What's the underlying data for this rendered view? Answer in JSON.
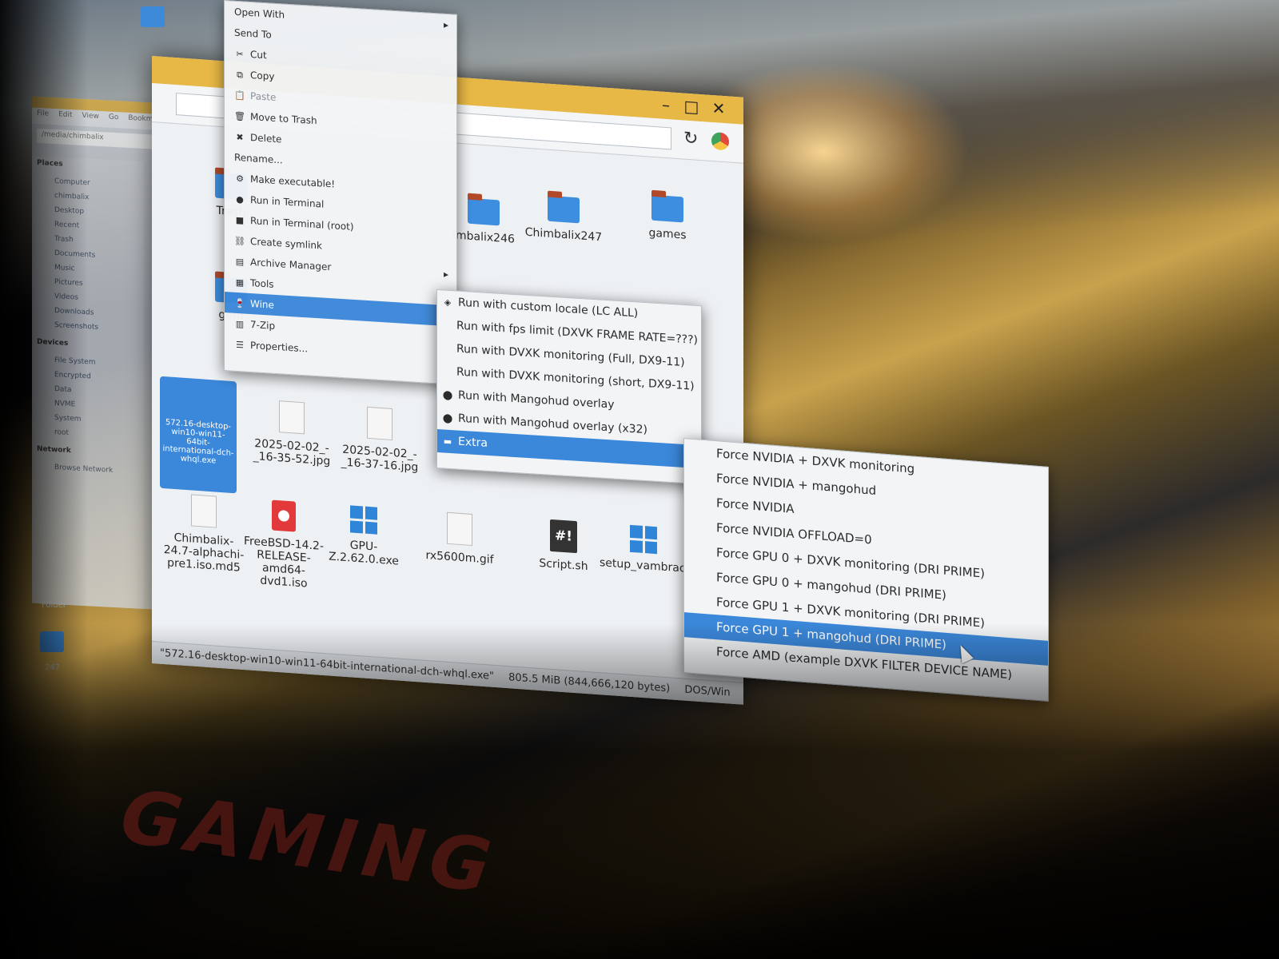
{
  "background_window": {
    "menubar": [
      "File",
      "Edit",
      "View",
      "Go",
      "Bookmarks",
      "H"
    ],
    "address": "/media/chimbalix",
    "places_header": "Places",
    "places": [
      "Computer",
      "chimbalix",
      "Desktop",
      "Recent",
      "Trash",
      "Documents",
      "Music",
      "Pictures",
      "Videos",
      "Downloads",
      "Screenshots"
    ],
    "devices_header": "Devices",
    "devices": [
      "File System",
      "Encrypted",
      "Data",
      "NVME",
      "System",
      "root"
    ],
    "network_header": "Network",
    "network": [
      "Browse Network"
    ]
  },
  "desktop": {
    "folder_label": "Folder",
    "folder2_label": "247"
  },
  "bezel_text": "GAMING",
  "window": {
    "controls": {
      "minimize": "–",
      "maximize": "□",
      "close": "✕"
    },
    "address": "",
    "reload_icon": "↻",
    "items": [
      {
        "label": "Trash",
        "kind": "folder"
      },
      {
        "label": "imbalix246",
        "kind": "folder"
      },
      {
        "label": "Chimbalix247",
        "kind": "folder"
      },
      {
        "label": "games",
        "kind": "folder"
      },
      {
        "label": "gem",
        "kind": "folder"
      },
      {
        "label": "2025-02-02_-_16-35-52.jpg",
        "kind": "file"
      },
      {
        "label": "2025-02-02_-_16-37-16.jpg",
        "kind": "file"
      },
      {
        "label": "Chimbalix-24.7-alphachi-pre1.iso.md5",
        "kind": "file"
      },
      {
        "label": "FreeBSD-14.2-RELEASE-amd64-dvd1.iso",
        "kind": "iso"
      },
      {
        "label": "GPU-Z.2.62.0.exe",
        "kind": "exe"
      },
      {
        "label": "rx5600m.gif",
        "kind": "file"
      },
      {
        "label": "Script.sh",
        "kind": "sh"
      },
      {
        "label": "setup_vambrace_cold_soul_1.11_(64bit)_(36921).exe",
        "kind": "exe"
      }
    ],
    "selected_item": "572.16-desktop-win10-win11-64bit-international-dch-whql.exe",
    "status": {
      "file": "\"572.16-desktop-win10-win11-64bit-international-dch-whql.exe\"",
      "size": "805.5 MiB (844,666,120 bytes)",
      "type": "DOS/Win"
    }
  },
  "context_menu": [
    {
      "label": "Open With",
      "submenu": true
    },
    {
      "label": "Send To",
      "submenu": false
    },
    {
      "label": "Cut",
      "icon": "cut-icon",
      "glyph": "✂"
    },
    {
      "label": "Copy",
      "icon": "copy-icon",
      "glyph": "⧉"
    },
    {
      "label": "Paste",
      "icon": "paste-icon",
      "glyph": "📋",
      "disabled": true
    },
    {
      "label": "Move to Trash",
      "icon": "trash-icon",
      "glyph": "🗑"
    },
    {
      "label": "Delete",
      "icon": "delete-icon",
      "glyph": "✖"
    },
    {
      "label": "Rename...",
      "icon": "",
      "glyph": ""
    },
    {
      "label": "Make executable!",
      "icon": "executable-icon",
      "glyph": "⚙"
    },
    {
      "label": "Run in Terminal",
      "icon": "terminal-icon",
      "glyph": "●"
    },
    {
      "label": "Run in Terminal (root)",
      "icon": "terminal-root-icon",
      "glyph": "■"
    },
    {
      "label": "Create symlink",
      "icon": "link-icon",
      "glyph": "⛓"
    },
    {
      "label": "Archive Manager",
      "icon": "archive-icon",
      "glyph": "▤",
      "submenu": true
    },
    {
      "label": "Tools",
      "icon": "tools-icon",
      "glyph": "▦",
      "submenu": true
    },
    {
      "label": "Wine",
      "icon": "wine-icon",
      "glyph": "🍷",
      "submenu": true,
      "highlighted": true
    },
    {
      "label": "7-Zip",
      "icon": "zip-icon",
      "glyph": "▥",
      "submenu": true
    },
    {
      "label": "Properties...",
      "icon": "properties-icon",
      "glyph": "☰"
    }
  ],
  "wine_menu": [
    {
      "label": "Run with custom locale (LC ALL)",
      "glyph": "◈"
    },
    {
      "label": "Run with fps limit (DXVK FRAME RATE=???)",
      "glyph": ""
    },
    {
      "label": "Run with DVXK monitoring (Full, DX9-11)",
      "glyph": ""
    },
    {
      "label": "Run with DVXK monitoring (short, DX9-11)",
      "glyph": ""
    },
    {
      "label": "Run with Mangohud overlay",
      "glyph": "⬤"
    },
    {
      "label": "Run with Mangohud overlay (x32)",
      "glyph": "⬤"
    },
    {
      "label": "Extra",
      "glyph": "▬",
      "submenu": true,
      "highlighted": true
    }
  ],
  "extra_menu": [
    {
      "label": "Force NVIDIA + DXVK monitoring"
    },
    {
      "label": "Force NVIDIA + mangohud"
    },
    {
      "label": "Force NVIDIA"
    },
    {
      "label": "Force NVIDIA OFFLOAD=0"
    },
    {
      "label": "Force GPU 0 + DXVK monitoring (DRI PRIME)"
    },
    {
      "label": "Force GPU 0 + mangohud (DRI PRIME)"
    },
    {
      "label": "Force GPU 1 + DXVK monitoring (DRI PRIME)"
    },
    {
      "label": "Force GPU 1 + mangohud (DRI PRIME)",
      "highlighted": true
    },
    {
      "label": "Force AMD (example DXVK FILTER DEVICE NAME)"
    }
  ],
  "colors": {
    "accent": "#3b87d9",
    "titlebar": "#e7b845"
  }
}
